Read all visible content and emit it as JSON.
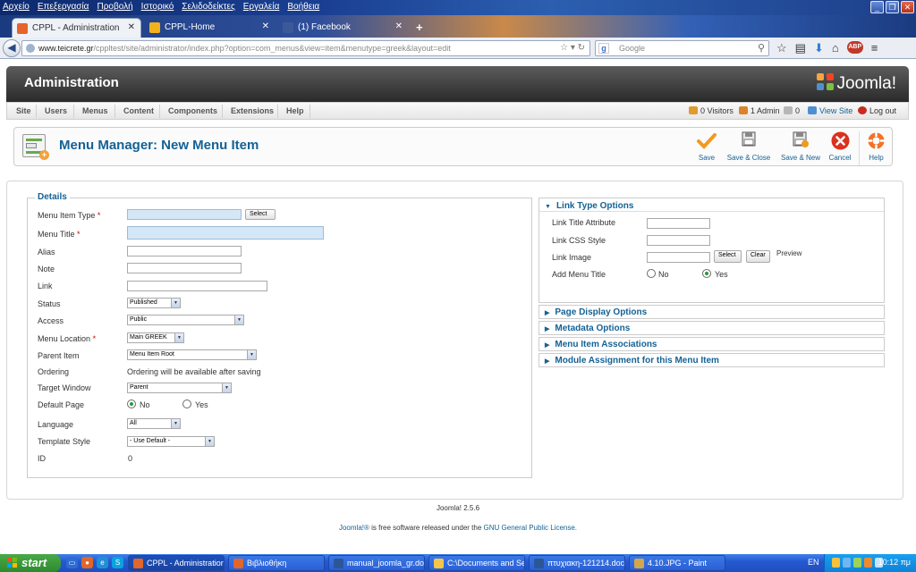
{
  "browser": {
    "menu": [
      "Αρχείο",
      "Επεξεργασία",
      "Προβολή",
      "Ιστορικό",
      "Σελιδοδείκτες",
      "Εργαλεία",
      "Βοήθεια"
    ],
    "tabs": [
      {
        "label": "CPPL - Administration",
        "color": "#e8632b"
      },
      {
        "label": "CPPL-Home",
        "color": "#f4b11d"
      },
      {
        "label": "(1) Facebook",
        "color": "#3b5998"
      }
    ],
    "url_domain": "www.teicrete.gr",
    "url_path": "/cppltest/site/administrator/index.php?option=com_menus&view=item&menutype=greek&layout=edit",
    "search_placeholder": "Google"
  },
  "header": {
    "title": "Administration",
    "logo_text": "Joomla!"
  },
  "menu": [
    "Site",
    "Users",
    "Menus",
    "Content",
    "Components",
    "Extensions",
    "Help"
  ],
  "status": {
    "visitors": "0 Visitors",
    "admin": "1 Admin",
    "messages": "0",
    "view_site": "View Site",
    "logout": "Log out"
  },
  "toolbar": {
    "page_title": "Menu Manager: New Menu Item",
    "buttons": [
      "Save",
      "Save & Close",
      "Save & New",
      "Cancel",
      "Help"
    ]
  },
  "details": {
    "legend": "Details",
    "labels": {
      "menu_item_type": "Menu Item Type",
      "menu_title": "Menu Title",
      "alias": "Alias",
      "note": "Note",
      "link": "Link",
      "status": "Status",
      "access": "Access",
      "menu_location": "Menu Location",
      "parent_item": "Parent Item",
      "ordering": "Ordering",
      "target_window": "Target Window",
      "default_page": "Default Page",
      "language": "Language",
      "template_style": "Template Style",
      "id": "ID"
    },
    "values": {
      "select_button": "Select",
      "status": "Published",
      "access": "Public",
      "menu_location": "Main GREEK",
      "parent_item": "Menu Item Root",
      "ordering": "Ordering will be available after saving",
      "target_window": "Parent",
      "default_no": "No",
      "default_yes": "Yes",
      "language": "All",
      "template_style": "- Use Default -",
      "id": "0"
    }
  },
  "link_type": {
    "title": "Link Type Options",
    "link_title_attribute": "Link Title Attribute",
    "link_css_style": "Link CSS Style",
    "link_image": "Link Image",
    "select_button": "Select",
    "clear_button": "Clear",
    "preview": "Preview",
    "add_menu_title": "Add Menu Title",
    "no": "No",
    "yes": "Yes"
  },
  "panels": [
    "Page Display Options",
    "Metadata Options",
    "Menu Item Associations",
    "Module Assignment for this Menu Item"
  ],
  "footer": {
    "version": "Joomla! 2.5.6",
    "brand": "Joomla!®",
    "license_text": " is free software released under the ",
    "license_link": "GNU General Public License."
  },
  "taskbar": {
    "start": "start",
    "tasks": [
      "CPPL - Administration...",
      "Βιβλιοθήκη",
      "manual_joomla_gr.do...",
      "C:\\Documents and Se...",
      "πτυχιακη-121214.doc...",
      "4.10.JPG - Paint"
    ],
    "lang": "EN",
    "clock": "10:12 πμ"
  }
}
